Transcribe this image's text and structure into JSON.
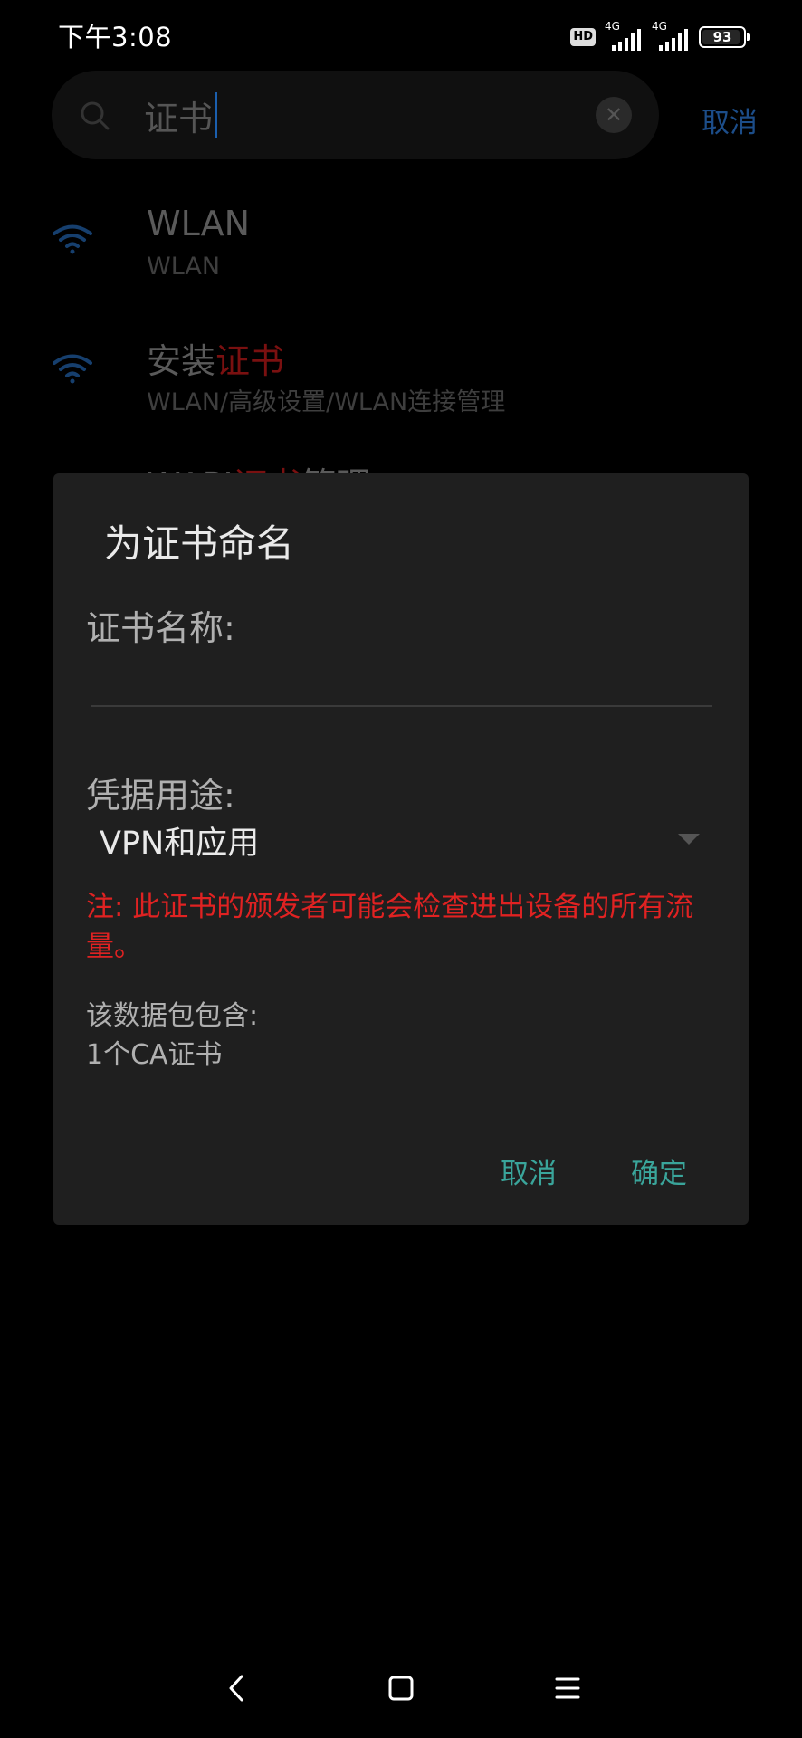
{
  "status_bar": {
    "time": "下午3:08",
    "hd": "HD",
    "net1": "4G",
    "net2": "4G",
    "battery": "93",
    "battery_level_pct": 93
  },
  "search": {
    "query": "证书",
    "cancel_label": "取消",
    "clear_icon": "close-icon"
  },
  "results": [
    {
      "title": "WLAN",
      "title_hl": "",
      "subtitle": "WLAN",
      "icon": "wifi-icon"
    },
    {
      "title": "安装",
      "title_hl": "证书",
      "subtitle": "WLAN/高级设置/WLAN连接管理",
      "icon": "wifi-icon"
    },
    {
      "title": "WAPI",
      "title_hl": "证书",
      "title_suffix": "管理"
    }
  ],
  "dialog": {
    "title": "为证书命名",
    "name_label": "证书名称:",
    "name_value": "",
    "usage_label": "凭据用途:",
    "usage_value": "VPN和应用",
    "warning": "注: 此证书的颁发者可能会检查进出设备的所有流量。",
    "package_label": "该数据包包含:",
    "package_content": "1个CA证书",
    "cancel_label": "取消",
    "ok_label": "确定"
  },
  "colors": {
    "accent_button": "#3aa59b",
    "warning": "#e02222",
    "search_cancel": "#1c4d89",
    "highlight": "#7a1010"
  },
  "nav": {
    "back_icon": "back-icon",
    "home_icon": "home-icon",
    "menu_icon": "menu-icon"
  }
}
